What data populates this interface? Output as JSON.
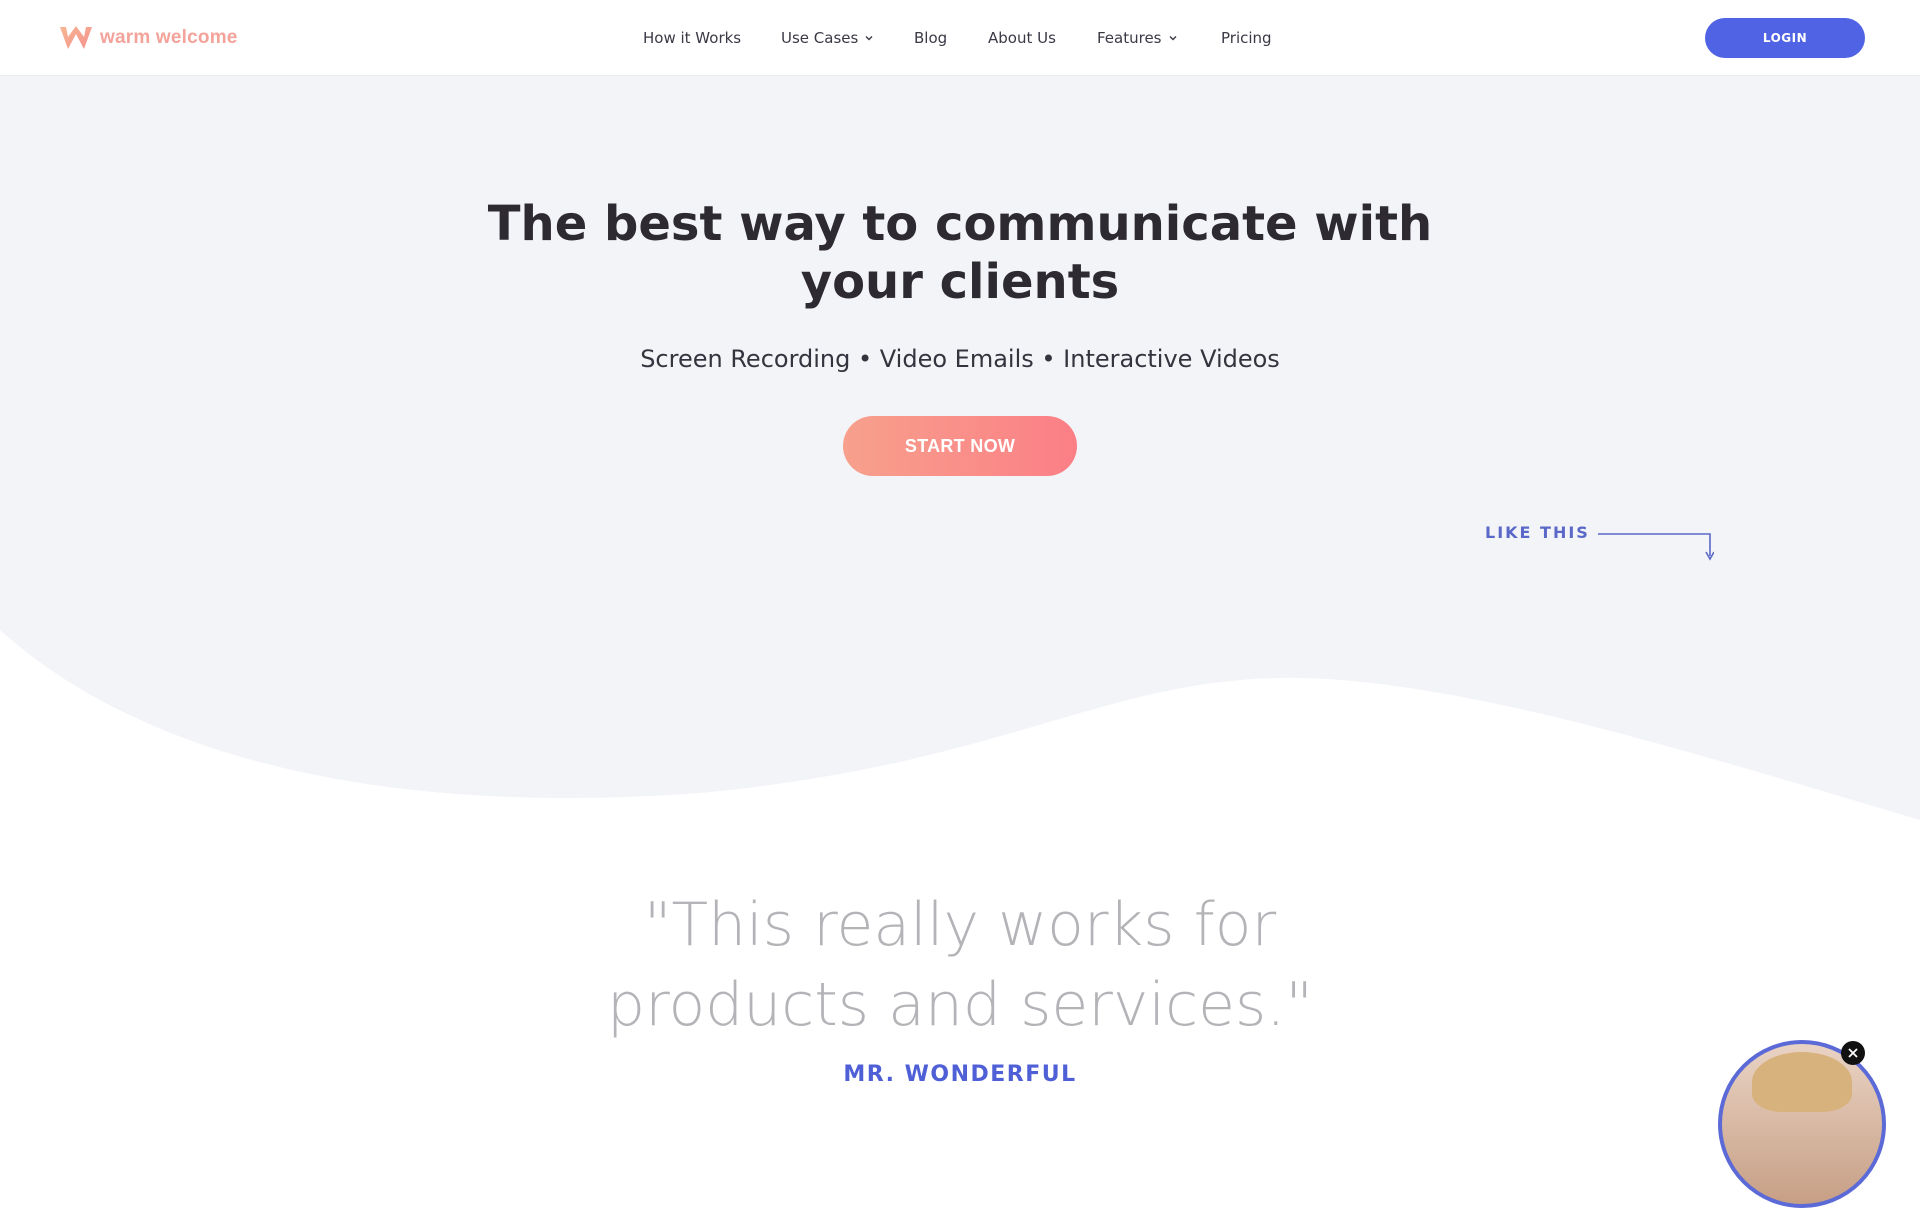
{
  "header": {
    "logo_text": "warm welcome",
    "nav": [
      {
        "label": "How it Works"
      },
      {
        "label": "Use Cases",
        "has_dropdown": true
      },
      {
        "label": "Blog"
      },
      {
        "label": "About Us"
      },
      {
        "label": "Features",
        "has_dropdown": true
      },
      {
        "label": "Pricing"
      }
    ],
    "login_label": "LOGIN"
  },
  "hero": {
    "title_line1": "The best way to communicate with",
    "title_line2": "your clients",
    "subtitle": "Screen Recording • Video Emails • Interactive Videos",
    "cta_label": "START NOW",
    "like_this": "LIKE THIS"
  },
  "testimonial": {
    "quote_line1": "\"This really works for",
    "quote_line2": "products and services.\"",
    "author": "MR. WONDERFUL"
  },
  "colors": {
    "accent_blue": "#4f63e4",
    "cta_gradient_start": "#f8a08c",
    "cta_gradient_end": "#fb7f86",
    "hero_bg": "#f3f4f8",
    "logo_color": "#f4a39a"
  },
  "icons": {
    "logo": "warm-welcome-logo-icon",
    "dropdown": "chevron-down-icon",
    "arrow": "arrow-down-right-icon",
    "close": "close-icon"
  }
}
